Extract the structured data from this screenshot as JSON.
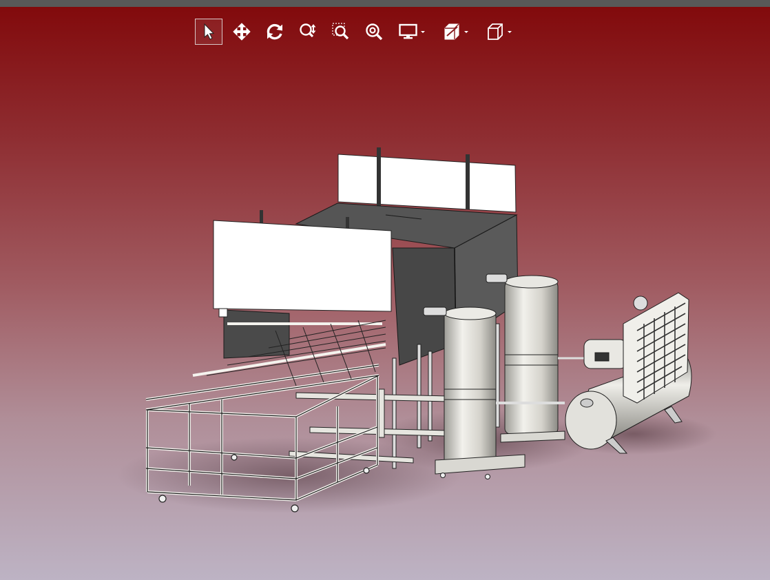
{
  "toolbar": {
    "tools": [
      {
        "name": "select-tool",
        "icon": "arrow-cursor-icon",
        "active": true
      },
      {
        "name": "pan-tool",
        "icon": "four-way-arrow-icon",
        "active": false
      },
      {
        "name": "rotate-tool",
        "icon": "rotate-icon",
        "active": false
      },
      {
        "name": "zoom-tool",
        "icon": "zoom-updown-icon",
        "active": false
      },
      {
        "name": "zoom-window-tool",
        "icon": "zoom-window-icon",
        "active": false
      },
      {
        "name": "zoom-fit-tool",
        "icon": "zoom-fit-icon",
        "active": false
      },
      {
        "name": "display-mode-dropdown",
        "icon": "monitor-icon",
        "active": false
      },
      {
        "name": "section-view-dropdown",
        "icon": "section-cube-icon",
        "active": false
      },
      {
        "name": "standard-views-dropdown",
        "icon": "cube-icon",
        "active": false
      }
    ]
  },
  "colors": {
    "titlebar": "#585858",
    "bg_top": "#820a0c",
    "bg_bottom": "#bdb3c4",
    "metal": "#d8d6cf",
    "panel": "#4e4e4e",
    "outline": "#1a1a1a"
  },
  "scene": {
    "objects": [
      "washing-tank",
      "front-cover-panel",
      "rear-cover-panel",
      "roller-conveyor-frame",
      "vertical-tank-left",
      "vertical-tank-right",
      "air-compressor"
    ]
  }
}
